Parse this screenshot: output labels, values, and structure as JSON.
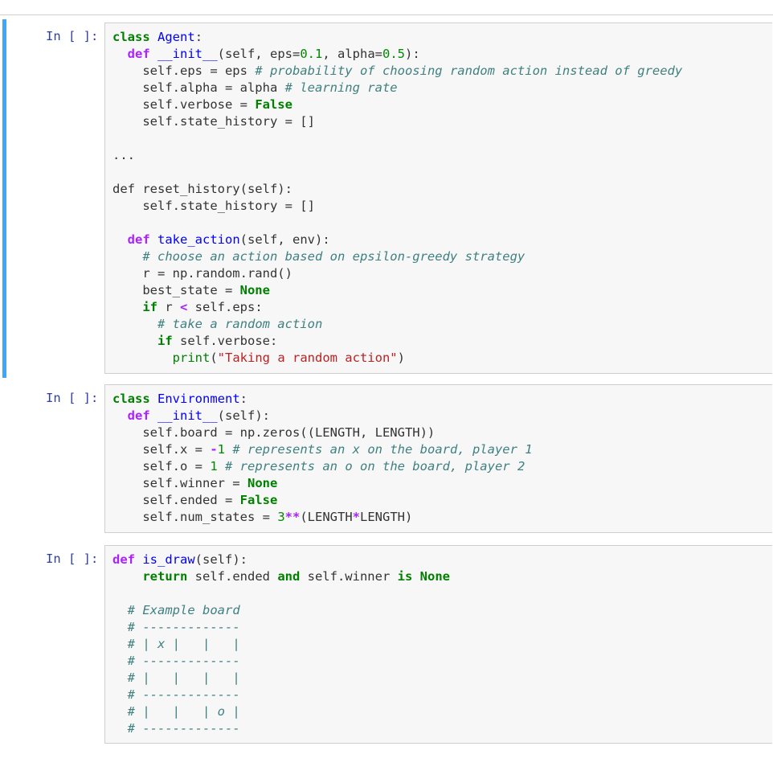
{
  "notebook": {
    "cells": [
      {
        "prompt": "In [ ]:",
        "selected": true,
        "lines": [
          [
            [
              "class",
              "kw"
            ],
            [
              " ",
              ""
            ],
            [
              "Agent",
              "nm"
            ],
            [
              ":",
              ""
            ]
          ],
          [
            [
              "  ",
              ""
            ],
            [
              "def",
              "def"
            ],
            [
              " ",
              ""
            ],
            [
              "__init__",
              "nm"
            ],
            [
              "(self, eps=",
              ""
            ],
            [
              "0.1",
              "num"
            ],
            [
              ", alpha=",
              ""
            ],
            [
              "0.5",
              "num"
            ],
            [
              "):",
              ""
            ]
          ],
          [
            [
              "    self.eps = eps ",
              ""
            ],
            [
              "# probability of choosing random action instead of greedy",
              "cm"
            ]
          ],
          [
            [
              "    self.alpha = alpha ",
              ""
            ],
            [
              "# learning rate",
              "cm"
            ]
          ],
          [
            [
              "    self.verbose = ",
              ""
            ],
            [
              "False",
              "kw"
            ]
          ],
          [
            [
              "    self.state_history = []",
              ""
            ]
          ],
          [
            [
              "",
              ""
            ]
          ],
          [
            [
              "...",
              ""
            ]
          ],
          [
            [
              "",
              ""
            ]
          ],
          [
            [
              "def reset_history(self):",
              ""
            ]
          ],
          [
            [
              "    self.state_history = []",
              ""
            ]
          ],
          [
            [
              "",
              ""
            ]
          ],
          [
            [
              "  ",
              ""
            ],
            [
              "def",
              "def"
            ],
            [
              " ",
              ""
            ],
            [
              "take_action",
              "nm"
            ],
            [
              "(self, env):",
              ""
            ]
          ],
          [
            [
              "    ",
              ""
            ],
            [
              "# choose an action based on epsilon-greedy strategy",
              "cm"
            ]
          ],
          [
            [
              "    r = np.random.rand()",
              ""
            ]
          ],
          [
            [
              "    best_state = ",
              ""
            ],
            [
              "None",
              "kw"
            ]
          ],
          [
            [
              "    ",
              ""
            ],
            [
              "if",
              "kw"
            ],
            [
              " r ",
              ""
            ],
            [
              "<",
              "op"
            ],
            [
              " self.eps:",
              ""
            ]
          ],
          [
            [
              "      ",
              ""
            ],
            [
              "# take a random action",
              "cm"
            ]
          ],
          [
            [
              "      ",
              ""
            ],
            [
              "if",
              "kw"
            ],
            [
              " self.verbose:",
              ""
            ]
          ],
          [
            [
              "        ",
              ""
            ],
            [
              "print",
              "nb"
            ],
            [
              "(",
              ""
            ],
            [
              "\"Taking a random action\"",
              "str"
            ],
            [
              ")",
              ""
            ]
          ]
        ]
      },
      {
        "prompt": "In [ ]:",
        "selected": false,
        "lines": [
          [
            [
              "class",
              "kw"
            ],
            [
              " ",
              ""
            ],
            [
              "Environment",
              "nm"
            ],
            [
              ":",
              ""
            ]
          ],
          [
            [
              "  ",
              ""
            ],
            [
              "def",
              "def"
            ],
            [
              " ",
              ""
            ],
            [
              "__init__",
              "nm"
            ],
            [
              "(self):",
              ""
            ]
          ],
          [
            [
              "    self.board = np.zeros((LENGTH, LENGTH))",
              ""
            ]
          ],
          [
            [
              "    self.x = ",
              ""
            ],
            [
              "-",
              "op"
            ],
            [
              "1",
              "num"
            ],
            [
              " ",
              ""
            ],
            [
              "# represents an x on the board, player 1",
              "cm"
            ]
          ],
          [
            [
              "    self.o = ",
              ""
            ],
            [
              "1",
              "num"
            ],
            [
              " ",
              ""
            ],
            [
              "# represents an o on the board, player 2",
              "cm"
            ]
          ],
          [
            [
              "    self.winner = ",
              ""
            ],
            [
              "None",
              "kw"
            ]
          ],
          [
            [
              "    self.ended = ",
              ""
            ],
            [
              "False",
              "kw"
            ]
          ],
          [
            [
              "    self.num_states = ",
              ""
            ],
            [
              "3",
              "num"
            ],
            [
              "**",
              "op"
            ],
            [
              "(LENGTH",
              ""
            ],
            [
              "*",
              "op"
            ],
            [
              "LENGTH)",
              ""
            ]
          ]
        ]
      },
      {
        "prompt": "In [ ]:",
        "selected": false,
        "lines": [
          [
            [
              "def",
              "def"
            ],
            [
              " ",
              ""
            ],
            [
              "is_draw",
              "nm"
            ],
            [
              "(self):",
              ""
            ]
          ],
          [
            [
              "    ",
              ""
            ],
            [
              "return",
              "kw"
            ],
            [
              " self.ended ",
              ""
            ],
            [
              "and",
              "kw"
            ],
            [
              " self.winner ",
              ""
            ],
            [
              "is",
              "kw"
            ],
            [
              " ",
              ""
            ],
            [
              "None",
              "kw"
            ]
          ],
          [
            [
              "",
              ""
            ]
          ],
          [
            [
              "  ",
              ""
            ],
            [
              "# Example board",
              "cm"
            ]
          ],
          [
            [
              "  ",
              ""
            ],
            [
              "# -------------",
              "cm"
            ]
          ],
          [
            [
              "  ",
              ""
            ],
            [
              "# | x |   |   |",
              "cm"
            ]
          ],
          [
            [
              "  ",
              ""
            ],
            [
              "# -------------",
              "cm"
            ]
          ],
          [
            [
              "  ",
              ""
            ],
            [
              "# |   |   |   |",
              "cm"
            ]
          ],
          [
            [
              "  ",
              ""
            ],
            [
              "# -------------",
              "cm"
            ]
          ],
          [
            [
              "  ",
              ""
            ],
            [
              "# |   |   | o |",
              "cm"
            ]
          ],
          [
            [
              "  ",
              ""
            ],
            [
              "# -------------",
              "cm"
            ]
          ]
        ]
      }
    ]
  }
}
